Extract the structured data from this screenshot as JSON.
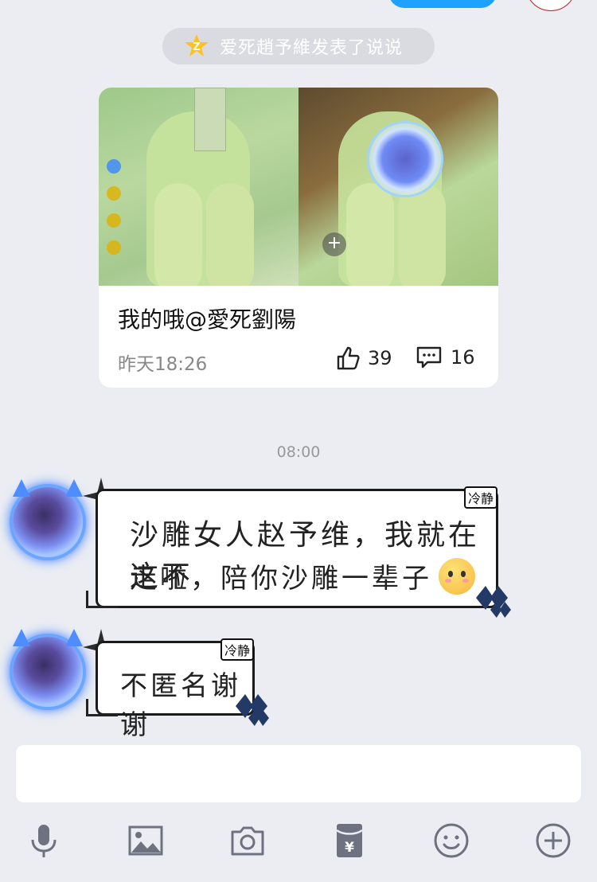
{
  "notice": {
    "text": "爱死趙予維发表了说说"
  },
  "post": {
    "caption": "我的哦@愛死劉陽",
    "time": "昨天18:26",
    "likes": "39",
    "comments": "16"
  },
  "chat": {
    "timestamp": "08:00",
    "messages": [
      {
        "tag": "冷静",
        "line1": "沙雕女人赵予维，我就在这不",
        "line2": "走啦，陪你沙雕一辈子"
      },
      {
        "tag": "冷静",
        "line1": "不匿名谢谢"
      }
    ]
  },
  "toolbar": {
    "items": [
      "microphone-icon",
      "image-icon",
      "camera-icon",
      "red-packet-icon",
      "emoji-icon",
      "plus-icon"
    ]
  },
  "colors": {
    "background": "#ebedf3",
    "notice_bg": "#d9dbe1",
    "accent_blue": "#1ea2ff",
    "icon_gray": "#6e7280"
  }
}
